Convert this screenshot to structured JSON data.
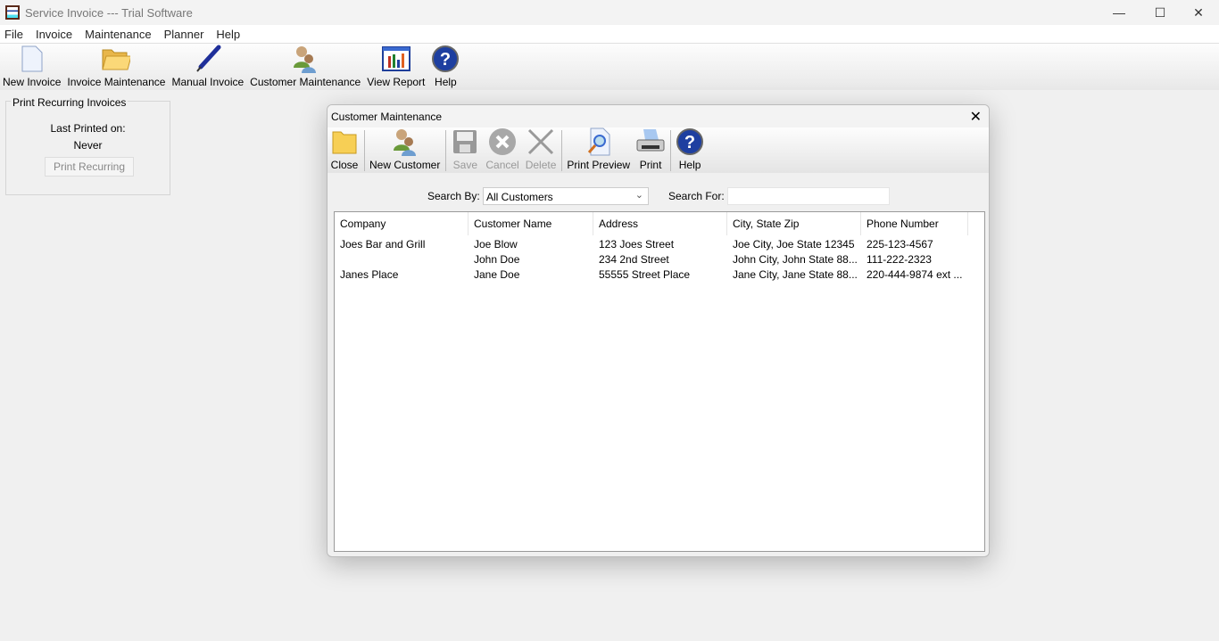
{
  "window": {
    "title": "Service Invoice --- Trial Software",
    "minimize": "—",
    "maximize": "☐",
    "close": "✕"
  },
  "menu": [
    "File",
    "Invoice",
    "Maintenance",
    "Planner",
    "Help"
  ],
  "toolbar": [
    "New Invoice",
    "Invoice Maintenance",
    "Manual Invoice",
    "Customer Maintenance",
    "View Report",
    "Help"
  ],
  "recurring": {
    "title": "Print Recurring Invoices",
    "last_printed_label": "Last Printed on:",
    "last_printed_value": "Never",
    "button": "Print Recurring"
  },
  "dialog": {
    "title": "Customer Maintenance",
    "close": "✕",
    "toolbar": [
      "Close",
      "New Customer",
      "Save",
      "Cancel",
      "Delete",
      "Print Preview",
      "Print",
      "Help"
    ],
    "search_by_label": "Search By:",
    "search_by_value": "All Customers",
    "search_for_label": "Search For:",
    "search_for_value": "",
    "columns": [
      "Company",
      "Customer Name",
      "Address",
      "City, State Zip",
      "Phone Number"
    ],
    "rows": [
      [
        "Joes Bar and Grill",
        "Joe Blow",
        "123 Joes Street",
        "Joe City, Joe State 12345",
        "225-123-4567"
      ],
      [
        "",
        "John Doe",
        "234 2nd Street",
        "John City, John State 88...",
        "111-222-2323"
      ],
      [
        "Janes Place",
        "Jane Doe",
        "55555 Street Place",
        "Jane City, Jane State 88...",
        "220-444-9874 ext ..."
      ]
    ]
  }
}
